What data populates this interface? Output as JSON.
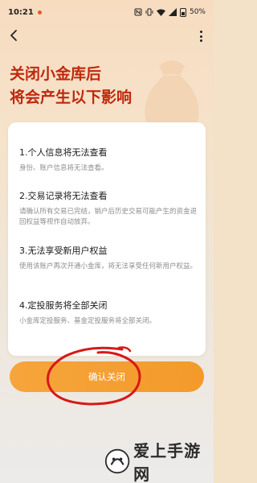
{
  "status_bar": {
    "time": "10:21",
    "battery": "50%"
  },
  "nav": {
    "back_icon": "chevron-left-icon",
    "more_icon": "more-vertical-icon"
  },
  "headline": {
    "line1": "关闭小金库后",
    "line2": "将会产生以下影响"
  },
  "impacts": [
    {
      "title": "1.个人信息将无法查看",
      "desc": "身份、账户信息将无法查看。"
    },
    {
      "title": "2.交易记录将无法查看",
      "desc": "请确认所有交易已完结，销户后历史交易可能产生的资金退回权益等视作自动放弃。"
    },
    {
      "title": "3.无法享受新用户权益",
      "desc": "使用该账户再次开通小金库，将无法享受任何新用户权益。"
    },
    {
      "title": "4.定投服务将全部关闭",
      "desc": "小金库定投服务、基金定投服务将全部关闭。"
    }
  ],
  "confirm_button": {
    "label": "确认关闭"
  },
  "watermark": {
    "text": "爱上手游网"
  },
  "colors": {
    "headline": "#c0280c",
    "button": "#f39a2a",
    "annotation": "#d91818"
  }
}
